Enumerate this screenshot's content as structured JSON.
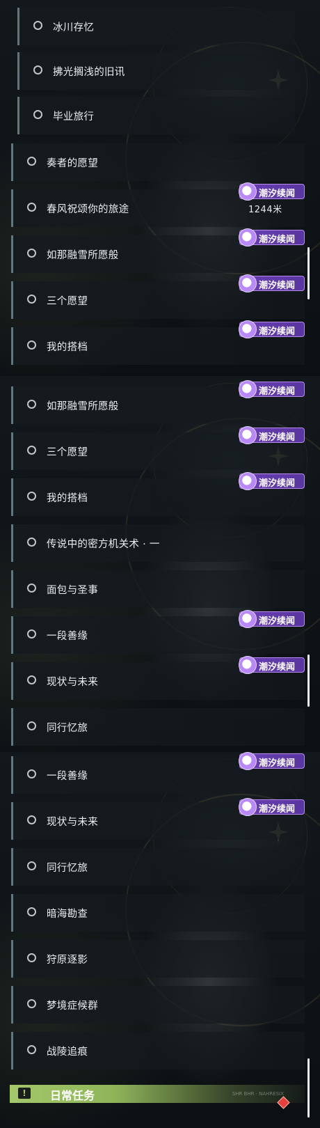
{
  "tag_label": "潮汐续闻",
  "colors": {
    "accent_purple": "#6a3fb3",
    "daily_green": "#a3c76a",
    "row_bar": "#63757d"
  },
  "icons": {
    "quest": "hollow-circle-icon",
    "tag": "tide-swirl-icon",
    "daily": "exclamation-icon",
    "marker": "red-diamond-icon"
  },
  "panel1": {
    "sub_quests": [
      "冰川存忆",
      "拂光搁浅的旧讯",
      "毕业旅行"
    ],
    "quests": [
      "奏者的愿望",
      "春风祝颂你的旅途",
      "如那融雪所愿般",
      "三个愿望",
      "我的搭档"
    ],
    "distance": "1244米"
  },
  "panel2": {
    "quests": [
      "如那融雪所愿般",
      "三个愿望",
      "我的搭档",
      "传说中的密方机关术 · 一",
      "面包与圣事",
      "一段善缘",
      "现状与未来",
      "同行忆旅"
    ]
  },
  "panel3": {
    "quests": [
      "一段善缘",
      "现状与未来",
      "同行忆旅",
      "暗海勘查",
      "狩原逐影",
      "梦境症候群",
      "战陵追痕"
    ],
    "daily_label": "日常任务",
    "daily_small": "SHR BHR · NAHRESIX"
  }
}
